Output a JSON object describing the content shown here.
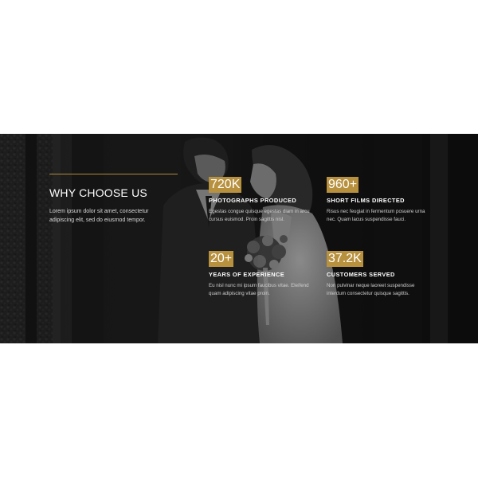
{
  "section": {
    "title": "WHY CHOOSE US",
    "description": "Lorem ipsum dolor sit amet, consectetur adipiscing elit, sed do eiusmod tempor."
  },
  "stats": [
    {
      "value": "720K",
      "label": "PHOTOGRAPHS PRODUCED",
      "description": "Egestas congue quisque egestas diam in arcu cursus euismod. Proin sagittis nisl."
    },
    {
      "value": "960+",
      "label": "SHORT FILMS DIRECTED",
      "description": "Risus nec feugiat in fermentum posuere urna nec. Quam lacus suspendisse fauci."
    },
    {
      "value": "20+",
      "label": "YEARS OF EXPERIENCE",
      "description": "Eu nisl nunc mi ipsum faucibus vitae. Eleifend quam adipiscing vitae proin."
    },
    {
      "value": "37.2K",
      "label": "CUSTOMERS SERVED",
      "description": "Non pulvinar neque laoreet suspendisse interdum consectetur quisque sagittis."
    }
  ],
  "colors": {
    "accent": "#b8913f",
    "band_background": "#161616",
    "page_background": "#ffffff"
  }
}
